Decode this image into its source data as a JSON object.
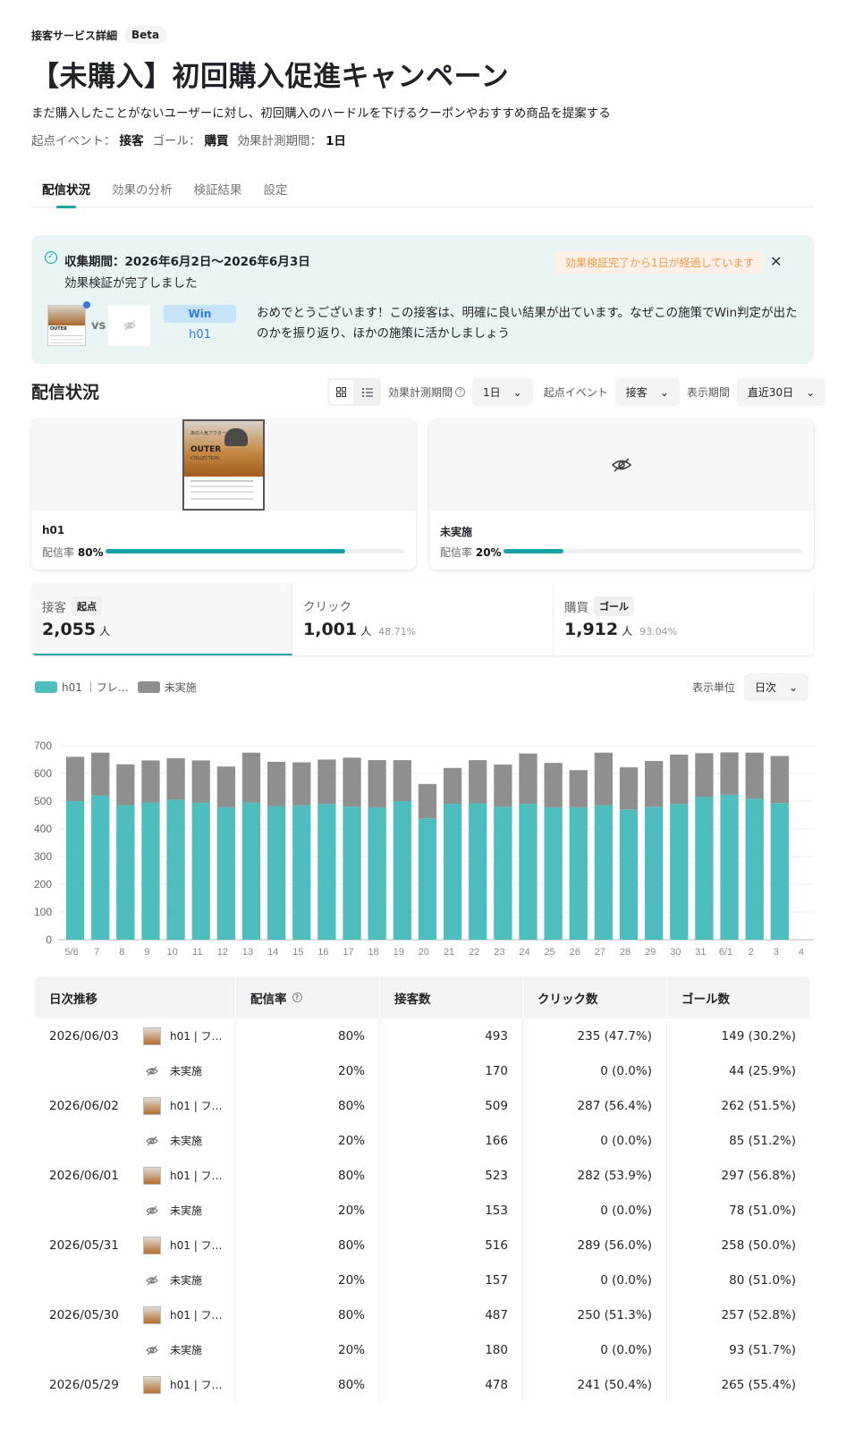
{
  "breadcrumb": {
    "label": "接客サービス詳細",
    "badge": "Beta"
  },
  "page": {
    "title": "【未購入】初回購入促進キャンペーン",
    "description": "まだ購入したことがないユーザーに対し、初回購入のハードルを下げるクーポンやおすすめ商品を提案する",
    "start_event_label": "起点イベント：",
    "start_event": "接客",
    "goal_label": "ゴール：",
    "goal": "購買",
    "period_label": "効果計測期間：",
    "period": "1日"
  },
  "tabs": [
    "配信状況",
    "効果の分析",
    "検証結果",
    "設定"
  ],
  "alert": {
    "title": "収集期間：2026年6月2日〜2026年6月3日",
    "subtitle": "効果検証が完了しました",
    "elapsed": "効果検証完了から1日が経過しています",
    "vs": "vs",
    "win_label": "Win",
    "win_variant": "h01",
    "message": "おめでとうございます！この接客は、明確に良い結果が出ています。なぜこの施策でWin判定が出たのかを振り返り、ほかの施策に活かしましょう"
  },
  "section": {
    "title": "配信状況",
    "period_label": "効果計測期間",
    "period_value": "1日",
    "event_label": "起点イベント",
    "event_value": "接客",
    "range_label": "表示期間",
    "range_value": "直近30日"
  },
  "variants": [
    {
      "name": "h01",
      "rate_label": "配信率",
      "rate": "80%",
      "rate_value": 0.8
    },
    {
      "name": "未実施",
      "rate_label": "配信率",
      "rate": "20%",
      "rate_value": 0.2
    }
  ],
  "creative": {
    "line1": "あの人気アウター",
    "line2": "OUTER",
    "line3": "COLLECTION"
  },
  "kpis": [
    {
      "label": "接客",
      "tag": "起点",
      "value": "2,055",
      "unit": "人",
      "pct": ""
    },
    {
      "label": "クリック",
      "tag": "",
      "value": "1,001",
      "unit": "人",
      "pct": "48.71%"
    },
    {
      "label": "購買",
      "tag": "ゴール",
      "value": "1,912",
      "unit": "人",
      "pct": "93.04%"
    }
  ],
  "legend": [
    {
      "name": "h01 ｜フレ…",
      "color": "#4dbdbd"
    },
    {
      "name": "未実施",
      "color": "#8e8f8f"
    }
  ],
  "display_unit": {
    "label": "表示単位",
    "value": "日次"
  },
  "chart_data": {
    "type": "bar",
    "stacked": true,
    "categories": [
      "5/6",
      "7",
      "8",
      "9",
      "10",
      "11",
      "12",
      "13",
      "14",
      "15",
      "16",
      "17",
      "18",
      "19",
      "20",
      "21",
      "22",
      "23",
      "24",
      "25",
      "26",
      "27",
      "28",
      "29",
      "30",
      "31",
      "6/1",
      "2",
      "3",
      "4"
    ],
    "series": [
      {
        "name": "h01 ｜フレ…",
        "color": "#4dbdbd",
        "values": [
          500,
          520,
          485,
          495,
          505,
          495,
          478,
          495,
          482,
          485,
          490,
          480,
          478,
          500,
          438,
          490,
          492,
          480,
          490,
          478,
          478,
          485,
          470,
          480,
          490,
          516,
          523,
          509,
          493,
          0
        ]
      },
      {
        "name": "未実施",
        "color": "#8e8f8f",
        "values": [
          160,
          155,
          148,
          152,
          150,
          152,
          147,
          180,
          160,
          155,
          160,
          177,
          170,
          148,
          124,
          130,
          156,
          152,
          182,
          160,
          134,
          190,
          152,
          165,
          178,
          157,
          153,
          166,
          170,
          0
        ]
      }
    ],
    "yticks": [
      0,
      100,
      200,
      300,
      400,
      500,
      600,
      700
    ],
    "ylim": [
      0,
      700
    ],
    "grid": true
  },
  "table": {
    "headers": [
      "日次推移",
      "配信率",
      "接客数",
      "クリック数",
      "ゴール数"
    ],
    "rows": [
      {
        "date": "2026/06/03",
        "variant": "h01 | フ…",
        "rate": "80%",
        "serve": "493",
        "click": "235 (47.7%)",
        "goal": "149 (30.2%)"
      },
      {
        "date": "",
        "variant": "未実施",
        "rate": "20%",
        "serve": "170",
        "click": "0 (0.0%)",
        "goal": "44 (25.9%)"
      },
      {
        "date": "2026/06/02",
        "variant": "h01 | フ…",
        "rate": "80%",
        "serve": "509",
        "click": "287 (56.4%)",
        "goal": "262 (51.5%)"
      },
      {
        "date": "",
        "variant": "未実施",
        "rate": "20%",
        "serve": "166",
        "click": "0 (0.0%)",
        "goal": "85 (51.2%)"
      },
      {
        "date": "2026/06/01",
        "variant": "h01 | フ…",
        "rate": "80%",
        "serve": "523",
        "click": "282 (53.9%)",
        "goal": "297 (56.8%)"
      },
      {
        "date": "",
        "variant": "未実施",
        "rate": "20%",
        "serve": "153",
        "click": "0 (0.0%)",
        "goal": "78 (51.0%)"
      },
      {
        "date": "2026/05/31",
        "variant": "h01 | フ…",
        "rate": "80%",
        "serve": "516",
        "click": "289 (56.0%)",
        "goal": "258 (50.0%)"
      },
      {
        "date": "",
        "variant": "未実施",
        "rate": "20%",
        "serve": "157",
        "click": "0 (0.0%)",
        "goal": "80 (51.0%)"
      },
      {
        "date": "2026/05/30",
        "variant": "h01 | フ…",
        "rate": "80%",
        "serve": "487",
        "click": "250 (51.3%)",
        "goal": "257 (52.8%)"
      },
      {
        "date": "",
        "variant": "未実施",
        "rate": "20%",
        "serve": "180",
        "click": "0 (0.0%)",
        "goal": "93 (51.7%)"
      },
      {
        "date": "2026/05/29",
        "variant": "h01 | フ…",
        "rate": "80%",
        "serve": "478",
        "click": "241 (50.4%)",
        "goal": "265 (55.4%)"
      }
    ]
  }
}
